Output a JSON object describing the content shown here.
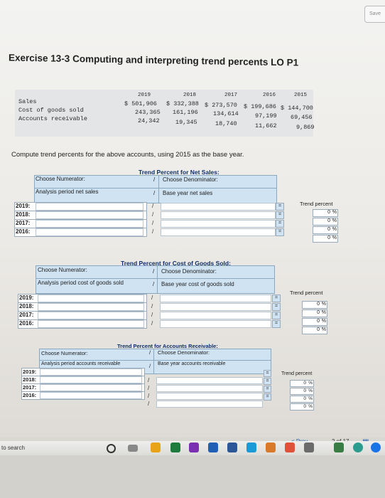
{
  "save_label": "Save",
  "title": "Exercise 13-3 Computing and interpreting trend percents LO P1",
  "data_table": {
    "years": [
      "2019",
      "2018",
      "2017",
      "2016",
      "2015"
    ],
    "rows": [
      {
        "label": "Sales",
        "values": [
          "$ 501,906",
          "$ 332,388",
          "$ 273,570",
          "$ 199,686",
          "$ 144,700"
        ]
      },
      {
        "label": "Cost of goods sold",
        "values": [
          "243,365",
          "161,196",
          "134,614",
          "97,199",
          "69,456"
        ]
      },
      {
        "label": "Accounts receivable",
        "values": [
          "24,342",
          "19,345",
          "18,740",
          "11,662",
          "9,869"
        ]
      }
    ]
  },
  "instruction": "Compute trend percents for the above accounts, using 2015 as the base year.",
  "sections": [
    {
      "title": "Trend Percent for Net Sales:",
      "numerator_header": "Choose Numerator:",
      "denominator_header": "Choose Denominator:",
      "numerator_value": "Analysis period net sales",
      "denominator_value": "Base year net sales",
      "trend_header": "Trend percent",
      "years": [
        "2019:",
        "2018:",
        "2017:",
        "2016:"
      ],
      "slash": "/",
      "equals": "=",
      "results": [
        "0",
        "0",
        "0",
        "0"
      ],
      "pct": "%"
    },
    {
      "title": "Trend Percent for Cost of Goods Sold:",
      "numerator_header": "Choose Numerator:",
      "denominator_header": "Choose Denominator:",
      "numerator_value": "Analysis period cost of goods sold",
      "denominator_value": "Base year cost of goods sold",
      "trend_header": "Trend percent",
      "years": [
        "2019:",
        "2018:",
        "2017:",
        "2016:"
      ],
      "slash": "/",
      "equals": "=",
      "results": [
        "0",
        "0",
        "0",
        "0"
      ],
      "pct": "%"
    },
    {
      "title": "Trend Percent for Accounts Receivable:",
      "numerator_header": "Choose Numerator:",
      "denominator_header": "Choose Denominator:",
      "numerator_value": "Analysis period accounts receivable",
      "denominator_value": "Base year accounts receivable",
      "trend_header": "Trend percent",
      "years": [
        "2019:",
        "2018:",
        "2017:",
        "2016:"
      ],
      "slash": "/",
      "equals": "=",
      "results": [
        "0",
        "0",
        "0",
        "0"
      ],
      "pct": "%"
    }
  ],
  "pager": {
    "prev": "< Prev",
    "page": "2 of 17"
  },
  "taskbar": {
    "search": "to search"
  },
  "colors": {
    "header_fill": "#cfe3f3",
    "link_blue": "#1a5fb4",
    "title_blue": "#0f2f6a"
  }
}
